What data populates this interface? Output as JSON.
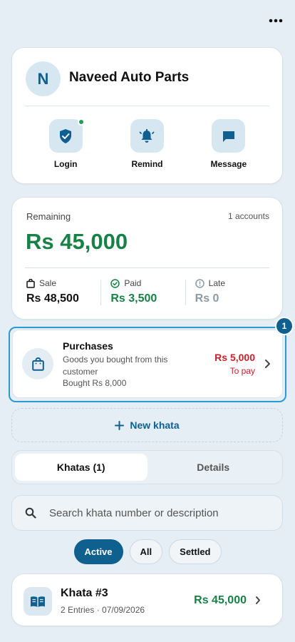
{
  "header": {
    "customer_initial": "N",
    "customer_name": "Naveed Auto Parts",
    "actions": [
      {
        "label": "Login",
        "icon": "shield-check-icon",
        "online": true
      },
      {
        "label": "Remind",
        "icon": "bell-icon"
      },
      {
        "label": "Message",
        "icon": "message-icon"
      }
    ]
  },
  "balance": {
    "remaining_label": "Remaining",
    "accounts": "1 accounts",
    "remaining_amount": "Rs 45,000",
    "sale_label": "Sale",
    "sale_value": "Rs 48,500",
    "paid_label": "Paid",
    "paid_value": "Rs 3,500",
    "late_label": "Late",
    "late_value": "Rs 0"
  },
  "purchases": {
    "badge": "1",
    "title": "Purchases",
    "description": "Goods you bought from this customer",
    "bought": "Bought Rs 8,000",
    "amount": "Rs 5,000",
    "status": "To pay"
  },
  "new_khata": {
    "label": "New khata"
  },
  "tabs": [
    {
      "label": "Khatas (1)",
      "active": true
    },
    {
      "label": "Details",
      "active": false
    }
  ],
  "search": {
    "placeholder": "Search khata number or description"
  },
  "filters": [
    {
      "label": "Active",
      "active": true
    },
    {
      "label": "All",
      "active": false
    },
    {
      "label": "Settled",
      "active": false
    }
  ],
  "khatas": [
    {
      "title": "Khata #3",
      "meta": "2 Entries · 07/09/2026",
      "amount": "Rs 45,000"
    }
  ],
  "colors": {
    "primary": "#0f5f8f",
    "positive": "#178245",
    "negative": "#c8222a",
    "muted": "#8a9aa6",
    "background": "#e6eef5",
    "highlight": "#2a9bd2"
  }
}
